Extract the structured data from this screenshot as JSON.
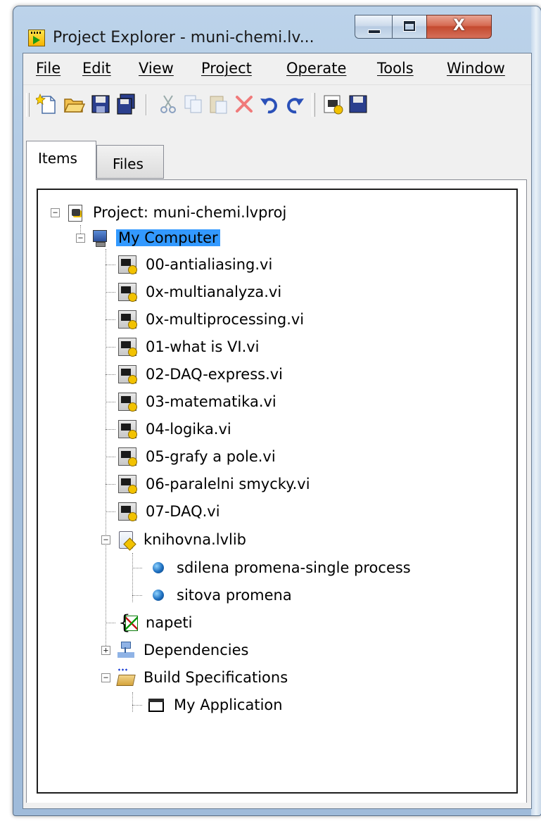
{
  "window": {
    "title": "Project Explorer - muni-chemi.lv...",
    "close_glyph": "X"
  },
  "menu": [
    "File",
    "Edit",
    "View",
    "Project",
    "Operate",
    "Tools",
    "Window"
  ],
  "toolbar": {
    "icons": [
      "new-icon",
      "open-icon",
      "save-icon",
      "save-all-icon",
      "cut-icon",
      "copy-icon",
      "paste-icon",
      "delete-icon",
      "undo-icon",
      "redo-icon",
      "build-icon",
      "save-spec-icon"
    ]
  },
  "tabs": {
    "items": "Items",
    "files": "Files"
  },
  "tree": {
    "project": "Project: muni-chemi.lvproj",
    "computer": "My Computer",
    "vis": [
      "00-antialiasing.vi",
      "0x-multianalyza.vi",
      "0x-multiprocessing.vi",
      "01-what is VI.vi",
      "02-DAQ-express.vi",
      "03-matematika.vi",
      "04-logika.vi",
      "05-grafy a pole.vi",
      "06-paralelni smycky.vi",
      "07-DAQ.vi"
    ],
    "library": "knihovna.lvlib",
    "library_items": [
      "sdilena promena-single process",
      "sitova promena"
    ],
    "variable": "napeti",
    "dependencies": "Dependencies",
    "build_specs": "Build Specifications",
    "application": "My Application"
  },
  "colors": {
    "selection": "#3399ff",
    "close_button": "#c44a2f"
  }
}
